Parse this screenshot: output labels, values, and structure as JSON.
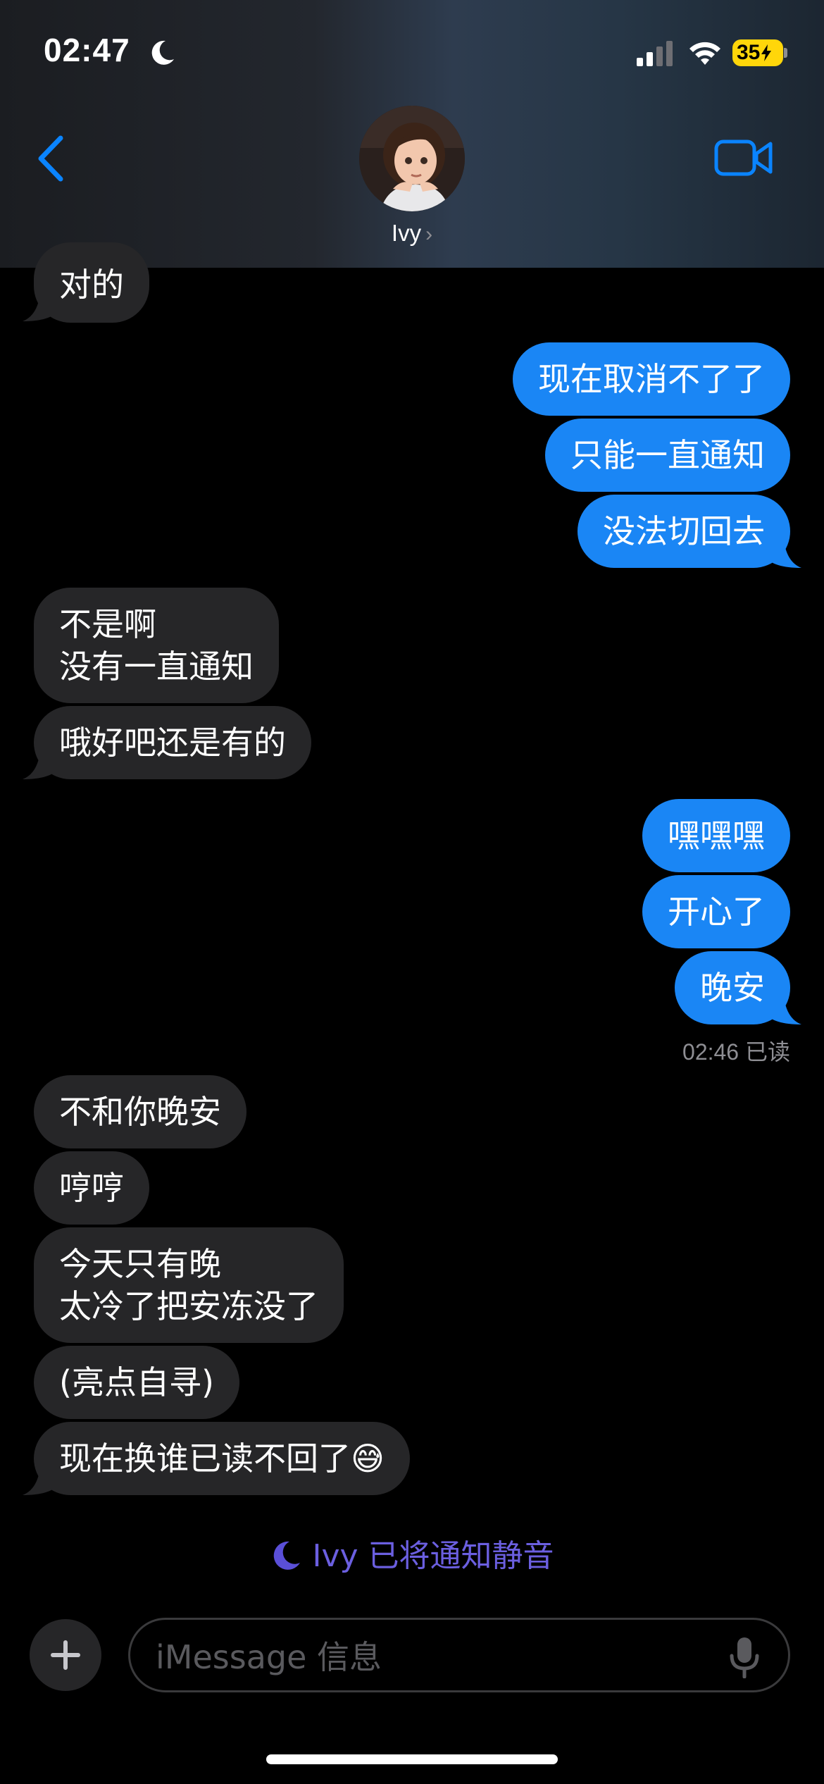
{
  "status_bar": {
    "time": "02:47",
    "battery": "35"
  },
  "header": {
    "contact_name": "Ivy",
    "chevron": "›"
  },
  "messages": {
    "m0": "对的",
    "m1": "现在取消不了了",
    "m2": "只能一直通知",
    "m3": "没法切回去",
    "m4": "不是啊\n没有一直通知",
    "m5": "哦好吧还是有的",
    "m6": "嘿嘿嘿",
    "m7": "开心了",
    "m8": "晚安",
    "m9": "不和你晚安",
    "m10": "哼哼",
    "m11": "今天只有晚\n太冷了把安冻没了",
    "m12": "(亮点自寻)",
    "m13": "现在换谁已读不回了😅"
  },
  "read_receipt": "02:46 已读",
  "muted_note": "Ivy 已将通知静音",
  "composer": {
    "placeholder": "iMessage 信息"
  },
  "colors": {
    "sent_bubble": "#1a86f5",
    "received_bubble": "#262628",
    "accent": "#0a84ff",
    "muted_text": "#6b5fe0"
  },
  "icons": [
    "moon-icon",
    "signal-icon",
    "wifi-icon",
    "battery-icon",
    "back-chevron-icon",
    "video-camera-icon",
    "plus-icon",
    "microphone-icon"
  ]
}
